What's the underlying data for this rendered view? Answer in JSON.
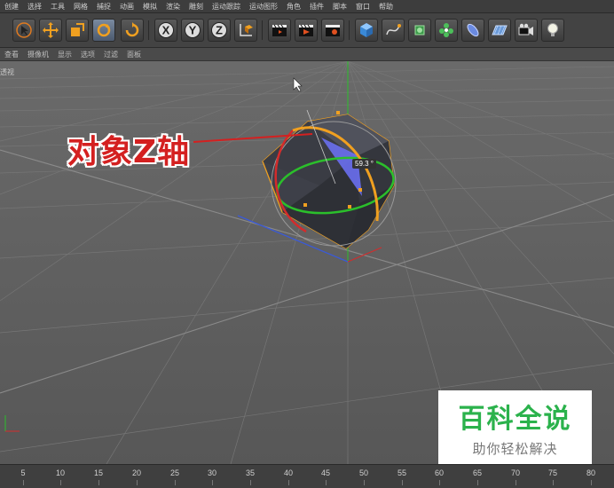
{
  "menubar": {
    "items": [
      "创建",
      "选择",
      "工具",
      "网格",
      "捕捉",
      "动画",
      "模拟",
      "渲染",
      "雕刻",
      "运动跟踪",
      "运动图形",
      "角色",
      "插件",
      "脚本",
      "窗口",
      "帮助"
    ]
  },
  "toolbar": {
    "tools": [
      "select-arrow",
      "move",
      "scale",
      "rotate",
      "live-selection",
      "x-axis-lock",
      "y-axis-lock",
      "z-axis-lock",
      "coordinate-system",
      "render-view",
      "render-picture-viewer",
      "render-settings",
      "cube",
      "spline-pen",
      "nurbs",
      "array",
      "deformer",
      "floor",
      "camera",
      "light"
    ],
    "x_label": "X",
    "y_label": "Y",
    "z_label": "Z"
  },
  "viewbar": {
    "items": [
      "查看",
      "摄像机",
      "显示",
      "选项",
      "过滤",
      "面板"
    ]
  },
  "viewport": {
    "label": "透视",
    "annotation": "对象Z轴",
    "rotation_readout": "59.3 °"
  },
  "timeline": {
    "ticks": [
      "5",
      "10",
      "15",
      "20",
      "25",
      "30",
      "35",
      "40",
      "45",
      "50",
      "55",
      "60",
      "65",
      "70",
      "75",
      "80"
    ]
  },
  "watermark": {
    "title": "百科全说",
    "subtitle": "助你轻松解决"
  },
  "colors": {
    "x_axis": "#d42b2b",
    "y_axis": "#2bbf2b",
    "z_axis": "#3a5ad8",
    "selection": "#f0a020",
    "watermark_green": "#2bb24c"
  }
}
